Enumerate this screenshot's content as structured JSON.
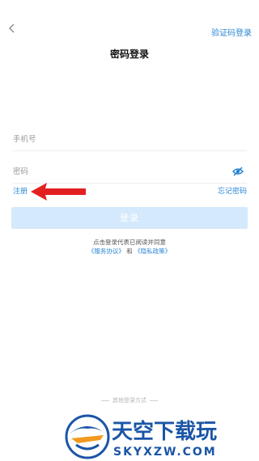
{
  "header": {
    "back": "‹",
    "title": "密码登录",
    "alt_login": "验证码登录"
  },
  "form": {
    "phone_placeholder": "手机号",
    "password_placeholder": "密码",
    "register": "注册",
    "forgot": "忘记密码",
    "submit": "登录"
  },
  "agreement": {
    "line1": "点击登录代表已阅读并同意",
    "terms": "《服务协议》",
    "and": "和",
    "privacy": "《隐私政策》"
  },
  "other_login": "其他登录方式",
  "watermark": {
    "cn": "天空下载玩",
    "en": "SKYXZW.COM"
  },
  "colors": {
    "accent": "#2b87d3",
    "button_disabled": "#d4e9fb",
    "arrow": "#e32020"
  }
}
